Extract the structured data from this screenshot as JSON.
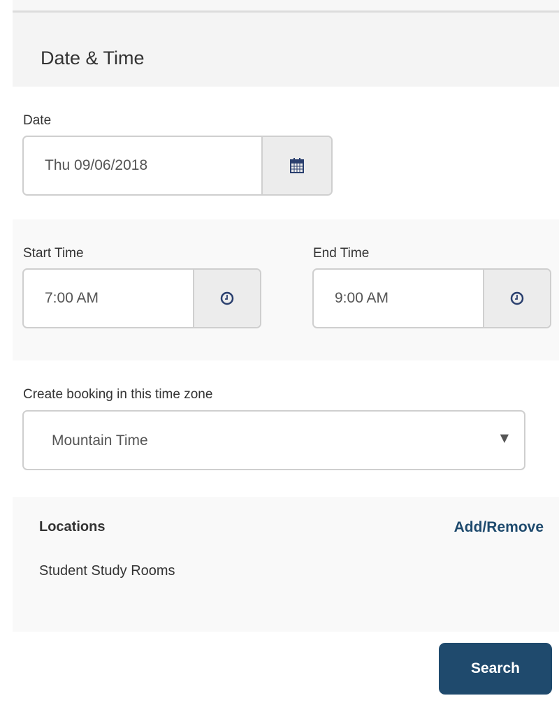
{
  "section": {
    "title": "Date & Time"
  },
  "date": {
    "label": "Date",
    "value": "Thu 09/06/2018",
    "icon": "calendar-icon"
  },
  "start_time": {
    "label": "Start Time",
    "value": "7:00 AM",
    "icon": "clock-icon"
  },
  "end_time": {
    "label": "End Time",
    "value": "9:00 AM",
    "icon": "clock-icon"
  },
  "timezone": {
    "label": "Create booking in this time zone",
    "value": "Mountain Time",
    "caret": "▼"
  },
  "locations": {
    "title": "Locations",
    "action": "Add/Remove",
    "items": [
      "Student Study Rooms"
    ]
  },
  "actions": {
    "search_label": "Search"
  },
  "colors": {
    "accent": "#1f4a6d",
    "icon": "#2a3f6e"
  }
}
